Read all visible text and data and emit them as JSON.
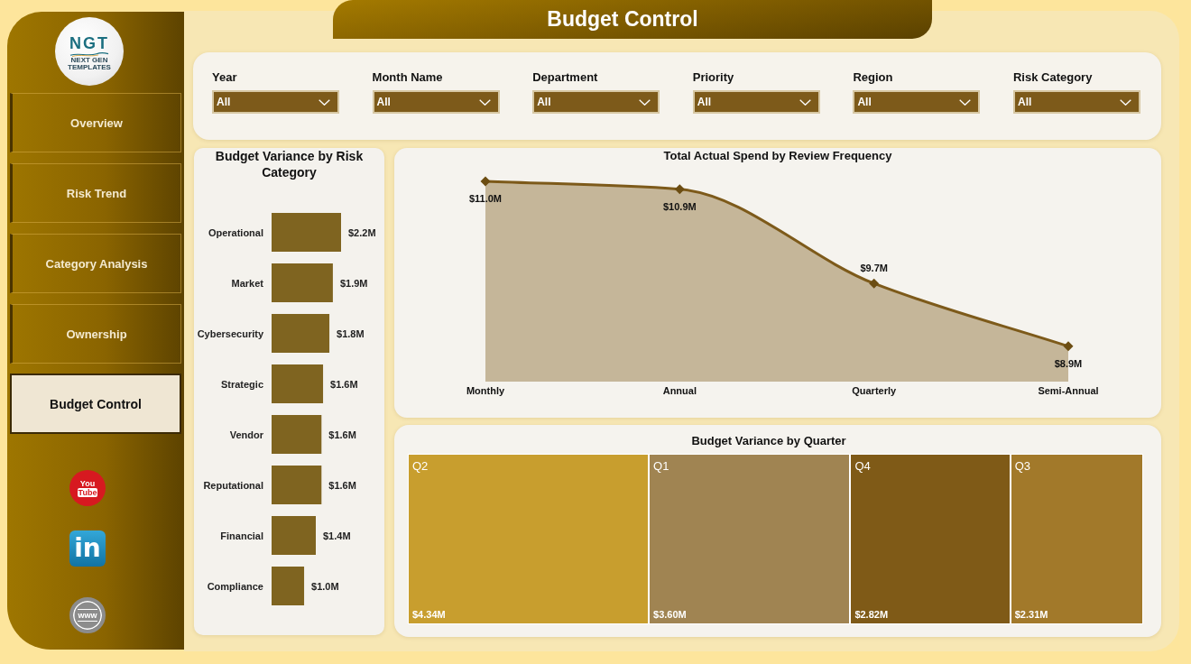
{
  "sidebar": {
    "logo": {
      "mark": "NGT",
      "tagline": "NEXT GEN TEMPLATES"
    },
    "nav": [
      {
        "label": "Overview",
        "selected": false
      },
      {
        "label": "Risk Trend",
        "selected": false
      },
      {
        "label": "Category Analysis",
        "selected": false
      },
      {
        "label": "Ownership",
        "selected": false
      },
      {
        "label": "Budget Control",
        "selected": true
      }
    ],
    "social_links": [
      {
        "kind": "youtube",
        "lines": [
          "You",
          "Tube"
        ]
      },
      {
        "kind": "linkedin",
        "lines": [
          "in"
        ]
      },
      {
        "kind": "web",
        "lines": [
          "www"
        ]
      }
    ]
  },
  "header": {
    "title": "Budget Control"
  },
  "filters": [
    {
      "label": "Year",
      "value": "All"
    },
    {
      "label": "Month Name",
      "value": "All"
    },
    {
      "label": "Department",
      "value": "All"
    },
    {
      "label": "Priority",
      "value": "All"
    },
    {
      "label": "Region",
      "value": "All"
    },
    {
      "label": "Risk Category",
      "value": "All"
    }
  ],
  "risk_category_chart": {
    "chart_data": {
      "type": "bar",
      "orientation": "horizontal",
      "title": "Budget Variance by Risk Category",
      "categories": [
        "Operational",
        "Market",
        "Cybersecurity",
        "Strategic",
        "Vendor",
        "Reputational",
        "Financial",
        "Compliance"
      ],
      "values": [
        2.2,
        1.94,
        1.83,
        1.63,
        1.58,
        1.58,
        1.4,
        1.03
      ],
      "value_labels": [
        "$2.2M",
        "$1.9M",
        "$1.8M",
        "$1.6M",
        "$1.6M",
        "$1.6M",
        "$1.4M",
        "$1.0M"
      ]
    }
  },
  "review_frequency_chart": {
    "chart_data": {
      "type": "area",
      "title": "Total Actual Spend by Review Frequency",
      "categories": [
        "Monthly",
        "Annual",
        "Quarterly",
        "Semi-Annual"
      ],
      "series": [
        {
          "color": "#7d5a1a",
          "values": [
            11.0,
            10.9,
            9.7,
            8.9
          ],
          "value_labels": [
            "$11.0M",
            "$10.9M",
            "$9.7M",
            "$8.9M"
          ]
        }
      ]
    }
  },
  "quarter_treemap": {
    "title": "Budget Variance by Quarter",
    "tiles": [
      {
        "label": "Q2",
        "value": "$4.34M",
        "color": "#c89e2e"
      },
      {
        "label": "Q1",
        "value": "$3.60M",
        "color": "#a08452"
      },
      {
        "label": "Q4",
        "value": "$2.82M",
        "color": "#7f5a17"
      },
      {
        "label": "Q3",
        "value": "$2.31M",
        "color": "#a2792a"
      }
    ]
  }
}
